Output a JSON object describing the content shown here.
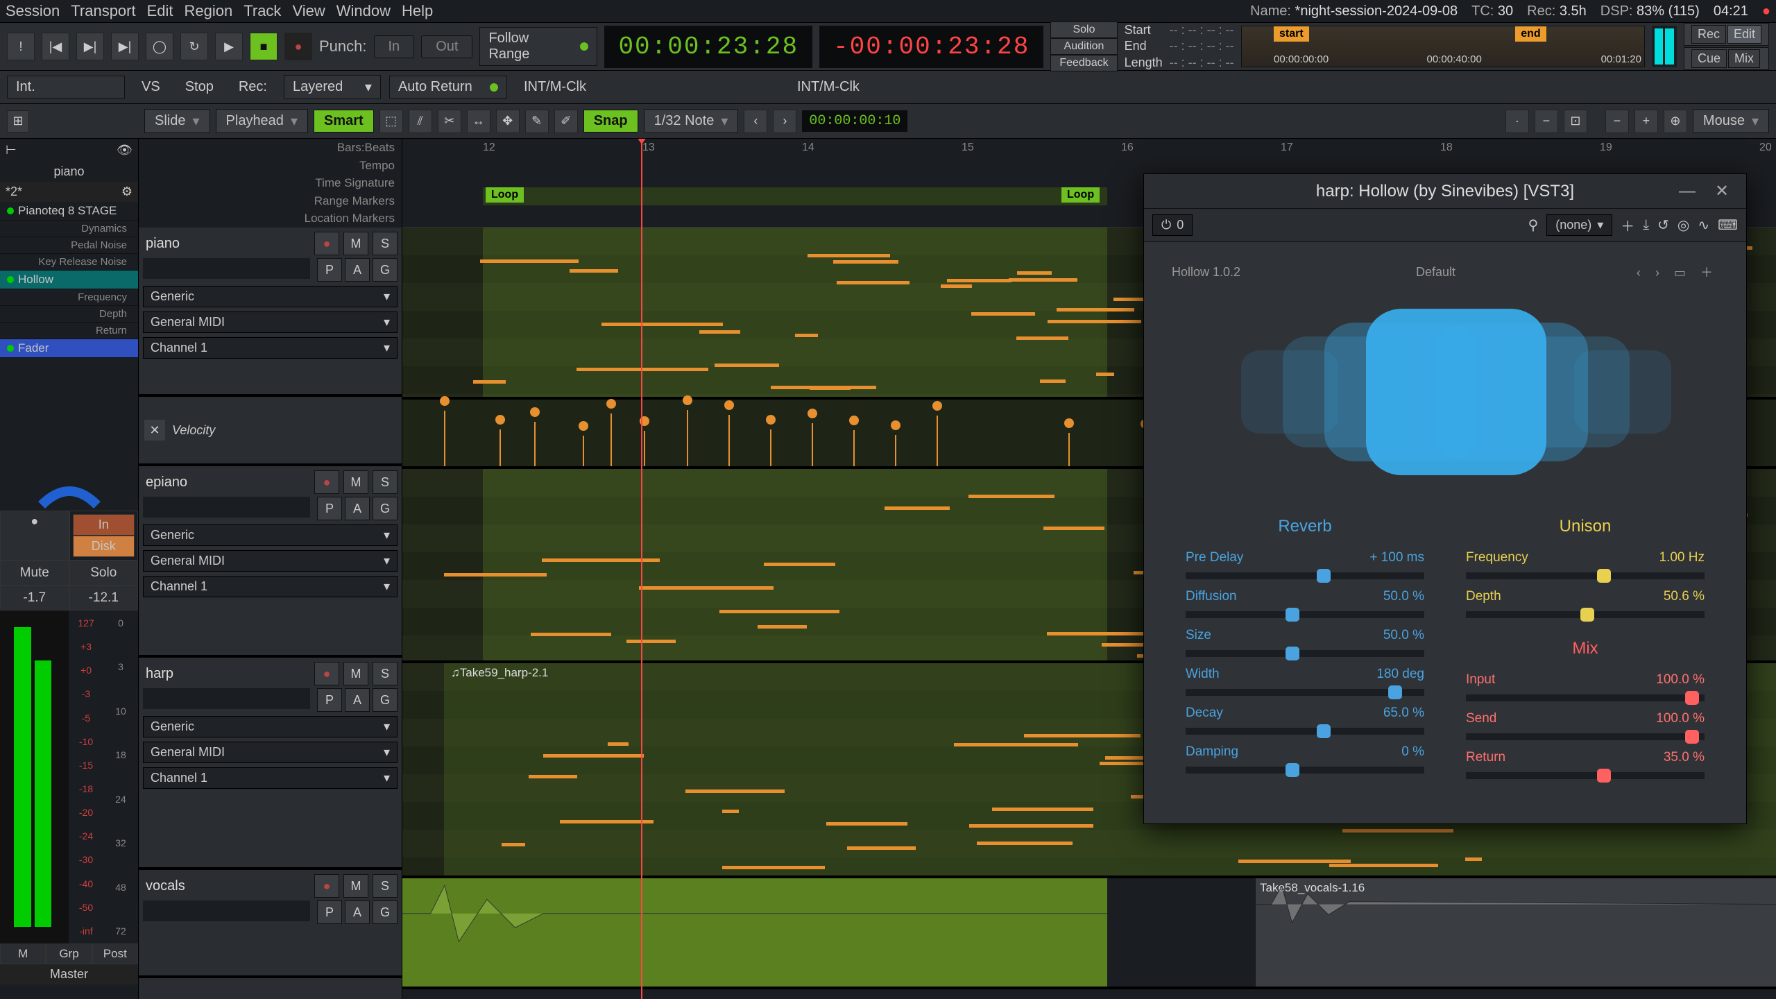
{
  "menu": [
    "Session",
    "Transport",
    "Edit",
    "Region",
    "Track",
    "View",
    "Window",
    "Help"
  ],
  "meta": {
    "name_label": "Name:",
    "name": "*night-session-2024-09-08",
    "tc_label": "TC:",
    "tc": "30",
    "rec_label": "Rec:",
    "rec": "3.5h",
    "dsp_label": "DSP:",
    "dsp": "83% (115)",
    "clock": "04:21"
  },
  "transport": {
    "punch": "Punch:",
    "in": "In",
    "out": "Out",
    "follow": "Follow Range",
    "tc_main": "00:00:23:28",
    "tc_delta": "-00:00:23:28",
    "solo": "Solo",
    "audition": "Audition",
    "feedback": "Feedback",
    "start": "Start",
    "end": "End",
    "length": "Length",
    "dashes": "-- : -- : -- : --",
    "start_tag": "start",
    "end_tag": "end",
    "t_left": "00:00:00:00",
    "t_mid": "00:00:40:00",
    "t_right": "00:01:20",
    "rec_btn": "Rec",
    "edit_btn": "Edit",
    "cue": "Cue",
    "mix": "Mix"
  },
  "toolbar2": {
    "int": "Int.",
    "vs": "VS",
    "stop": "Stop",
    "rec": "Rec:",
    "layered": "Layered",
    "autoreturn": "Auto Return",
    "int_mclk": "INT/M-Clk"
  },
  "toolbar3": {
    "slide": "Slide",
    "playhead": "Playhead",
    "smart": "Smart",
    "snap": "Snap",
    "grid": "1/32 Note",
    "tc": "00:00:00:10",
    "mouse": "Mouse"
  },
  "left": {
    "track": "piano",
    "star": "*2*",
    "plugins": [
      {
        "name": "Pianoteq 8 STAGE",
        "type": "main"
      },
      {
        "name": "Dynamics",
        "type": "sub"
      },
      {
        "name": "Pedal Noise",
        "type": "sub"
      },
      {
        "name": "Key Release Noise",
        "type": "sub"
      },
      {
        "name": "Hollow",
        "type": "active"
      },
      {
        "name": "Frequency",
        "type": "sub"
      },
      {
        "name": "Depth",
        "type": "sub"
      },
      {
        "name": "Return",
        "type": "sub"
      },
      {
        "name": "Fader",
        "type": "fader"
      }
    ],
    "in": "In",
    "disk": "Disk",
    "mute": "Mute",
    "solo": "Solo",
    "db_l": "-1.7",
    "db_r": "-12.1",
    "m": "M",
    "grp": "Grp",
    "post": "Post",
    "master": "Master",
    "fader_ticks": [
      "127",
      "+3",
      "+0",
      "-3",
      "-5",
      "-10",
      "-15",
      "-18",
      "-20",
      "-24",
      "-30",
      "-40",
      "-50",
      "-inf"
    ],
    "meter_ticks": [
      "0",
      "3",
      "10",
      "18",
      "24",
      "32",
      "48",
      "72"
    ]
  },
  "rulers": [
    "Bars:Beats",
    "Tempo",
    "Time Signature",
    "Range Markers",
    "Location Markers"
  ],
  "tracks": [
    {
      "name": "piano",
      "dd": [
        "Generic",
        "General MIDI",
        "Channel 1"
      ],
      "m": "M",
      "s": "S",
      "p": "P",
      "a": "A",
      "g": "G"
    },
    {
      "name": "epiano",
      "dd": [
        "Generic",
        "General MIDI",
        "Channel 1"
      ],
      "m": "M",
      "s": "S",
      "p": "P",
      "a": "A",
      "g": "G"
    },
    {
      "name": "harp",
      "dd": [
        "Generic",
        "General MIDI",
        "Channel 1"
      ],
      "m": "M",
      "s": "S",
      "p": "P",
      "a": "A",
      "g": "G",
      "region": "♫Take59_harp-2.1"
    },
    {
      "name": "vocals",
      "m": "M",
      "s": "S",
      "p": "P",
      "a": "A",
      "g": "G",
      "region": "Take58_vocals-1.16"
    }
  ],
  "velocity": "Velocity",
  "ruler_nums": [
    "12",
    "13",
    "14",
    "15",
    "16",
    "17",
    "18",
    "19",
    "20"
  ],
  "loop": "Loop",
  "plugin": {
    "title": "harp: Hollow (by Sinevibes) [VST3]",
    "latency": "0",
    "preset_sel": "(none)",
    "version": "Hollow 1.0.2",
    "preset": "Default",
    "reverb": "Reverb",
    "unison": "Unison",
    "mix": "Mix",
    "params_reverb": [
      {
        "n": "Pre Delay",
        "v": "+ 100 ms",
        "p": 55
      },
      {
        "n": "Diffusion",
        "v": "50.0 %",
        "p": 42
      },
      {
        "n": "Size",
        "v": "50.0 %",
        "p": 42
      },
      {
        "n": "Width",
        "v": "180 deg",
        "p": 85
      },
      {
        "n": "Decay",
        "v": "65.0 %",
        "p": 55
      },
      {
        "n": "Damping",
        "v": "0 %",
        "p": 42
      }
    ],
    "params_unison": [
      {
        "n": "Frequency",
        "v": "1.00 Hz",
        "p": 55
      },
      {
        "n": "Depth",
        "v": "50.6 %",
        "p": 48
      }
    ],
    "params_mix": [
      {
        "n": "Input",
        "v": "100.0 %",
        "p": 92
      },
      {
        "n": "Send",
        "v": "100.0 %",
        "p": 92
      },
      {
        "n": "Return",
        "v": "35.0 %",
        "p": 55
      }
    ]
  }
}
